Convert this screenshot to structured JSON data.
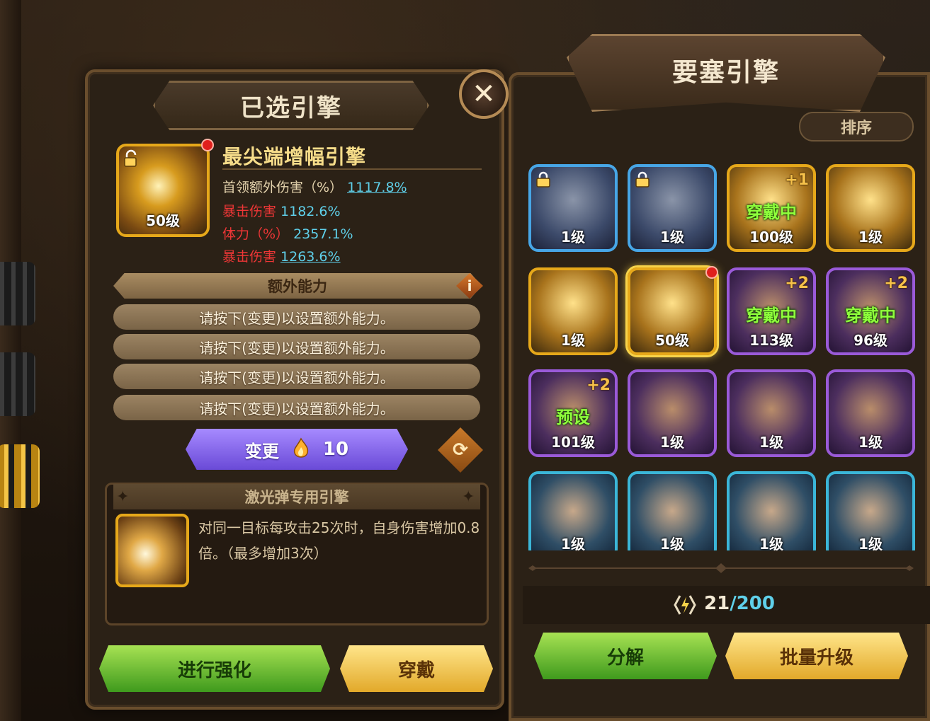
{
  "selected_engine_panel": {
    "title": "已选引擎",
    "close_label": "✕",
    "engine": {
      "name": "最尖端增幅引擎",
      "level": "50级",
      "stats": [
        {
          "label": "首领额外伤害（%）",
          "value": "1117.8%",
          "label_color": "plain",
          "underlined": true
        },
        {
          "label": "暴击伤害",
          "value": "1182.6%",
          "label_color": "red",
          "underlined": false
        },
        {
          "label": "体力（%）",
          "value": "2357.1%",
          "label_color": "red",
          "underlined": false
        },
        {
          "label": "暴击伤害",
          "value": "1263.6%",
          "label_color": "red",
          "underlined": true
        }
      ]
    },
    "bonus": {
      "header": "额外能力",
      "info_icon_label": "i",
      "slots": [
        "请按下(变更)以设置额外能力。",
        "请按下(变更)以设置额外能力。",
        "请按下(变更)以设置额外能力。",
        "请按下(变更)以设置额外能力。"
      ]
    },
    "change_button": {
      "label": "变更",
      "cost": "10",
      "icon": "flame-icon"
    },
    "refresh_icon_label": "⟳",
    "exclusive": {
      "header": "激光弹专用引擎",
      "description": "对同一目标每攻击25次时，自身伤害增加0.8倍。（最多增加3次）"
    },
    "enhance_label": "进行强化",
    "equip_label": "穿戴"
  },
  "fortress_engine_panel": {
    "title": "要塞引擎",
    "sort_label": "排序",
    "tiles": [
      {
        "level": "1级",
        "rarity": "blue",
        "locked": true,
        "tag": "",
        "plus": ""
      },
      {
        "level": "1级",
        "rarity": "blue",
        "locked": true,
        "tag": "",
        "plus": ""
      },
      {
        "level": "100级",
        "rarity": "gold",
        "locked": false,
        "tag": "穿戴中",
        "plus": "+1"
      },
      {
        "level": "1级",
        "rarity": "gold",
        "locked": false,
        "tag": "",
        "plus": ""
      },
      {
        "level": "1级",
        "rarity": "gold",
        "locked": false,
        "tag": "",
        "plus": ""
      },
      {
        "level": "50级",
        "rarity": "gold",
        "locked": false,
        "tag": "",
        "plus": "",
        "selected": true
      },
      {
        "level": "113级",
        "rarity": "purple",
        "locked": false,
        "tag": "穿戴中",
        "plus": "+2"
      },
      {
        "level": "96级",
        "rarity": "purple",
        "locked": false,
        "tag": "穿戴中",
        "plus": "+2"
      },
      {
        "level": "101级",
        "rarity": "purple",
        "locked": false,
        "tag": "预设",
        "plus": "+2"
      },
      {
        "level": "1级",
        "rarity": "purple",
        "locked": false,
        "tag": "",
        "plus": ""
      },
      {
        "level": "1级",
        "rarity": "purple",
        "locked": false,
        "tag": "",
        "plus": ""
      },
      {
        "level": "1级",
        "rarity": "purple",
        "locked": false,
        "tag": "",
        "plus": ""
      },
      {
        "level": "1级",
        "rarity": "cyan",
        "locked": false,
        "tag": "",
        "plus": ""
      },
      {
        "level": "1级",
        "rarity": "cyan",
        "locked": false,
        "tag": "",
        "plus": ""
      },
      {
        "level": "1级",
        "rarity": "cyan",
        "locked": false,
        "tag": "",
        "plus": ""
      },
      {
        "level": "1级",
        "rarity": "cyan",
        "locked": false,
        "tag": "",
        "plus": ""
      }
    ],
    "count": {
      "current": "21",
      "max": "/200"
    },
    "decompose_label": "分解",
    "batch_upgrade_label": "批量升级"
  },
  "colors": {
    "gold_border": "#e6a81a",
    "blue_border": "#47a6e6",
    "purple_border": "#9a5ad8",
    "cyan_border": "#3bb6d8",
    "value_cyan": "#5fd0ea",
    "stat_red": "#ee3636",
    "equipped_green": "#8fff3c"
  }
}
